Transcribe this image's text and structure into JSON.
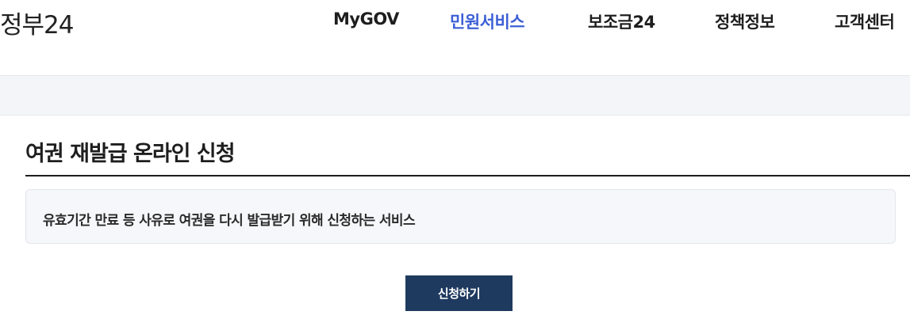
{
  "header": {
    "logo_text": "정부24",
    "nav": {
      "mygov": "MyGOV",
      "civil_service": "민원서비스",
      "subsidy": "보조금24",
      "policy": "정책정보",
      "support": "고객센터"
    },
    "active_nav": "civil_service",
    "active_color": "#3c5fd6"
  },
  "main": {
    "title": "여권 재발급 온라인 신청",
    "description": "유효기간 만료 등 사유로 여권을 다시 발급받기 위해 신청하는 서비스",
    "apply_button_label": "신청하기",
    "apply_button_color": "#1f3a5f"
  }
}
